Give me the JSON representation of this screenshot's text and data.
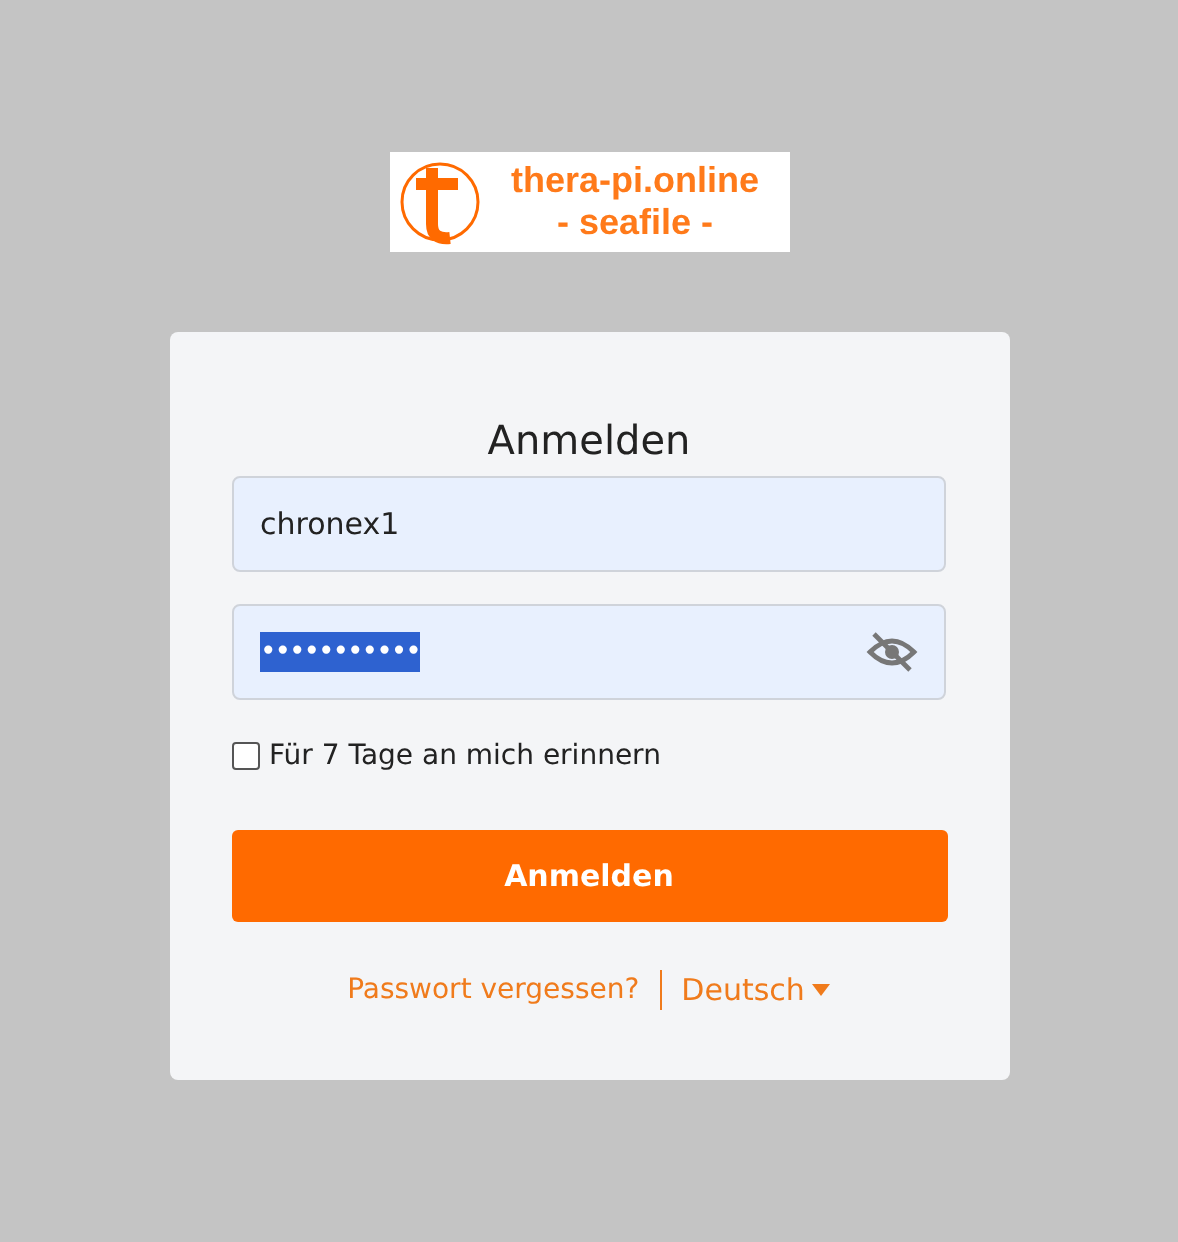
{
  "logo": {
    "title": "thera-pi.online",
    "subtitle": "- seafile -"
  },
  "card": {
    "title": "Anmelden",
    "username": {
      "value": "chronex1"
    },
    "password": {
      "masked_value": "•••••••••••",
      "text_selected": true,
      "visible": false
    },
    "remember": {
      "label": "Für 7 Tage an mich erinnern",
      "checked": false
    },
    "submit": "Anmelden",
    "forgot_link": "Passwort vergessen?",
    "language": "Deutsch"
  }
}
